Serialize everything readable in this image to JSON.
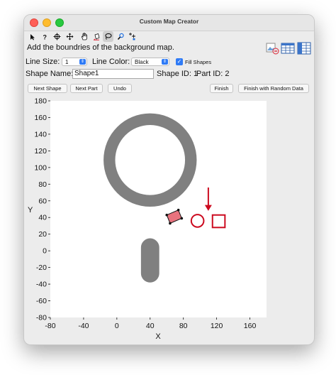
{
  "window": {
    "title": "Custom Map Creator"
  },
  "toolbar": {
    "tools": [
      "arrow-pointer-icon",
      "question-icon",
      "crosshair-icon",
      "move-icon",
      "hand-icon",
      "bucket-icon",
      "lasso-icon",
      "zoom-icon",
      "data-cursor-icon"
    ],
    "right_tools": [
      "image-export-icon",
      "table-icon",
      "table-columns-icon"
    ]
  },
  "instruction": "Add the boundries of the background map.",
  "controls": {
    "line_size_label": "Line Size:",
    "line_size_value": "1",
    "line_color_label": "Line Color:",
    "line_color_value": "Black",
    "fill_shapes_label": "Fill Shapes",
    "fill_shapes_checked": true,
    "shape_name_label": "Shape Name:",
    "shape_name_value": "Shape1",
    "shape_id_text": "Shape ID: 1",
    "part_id_text": "Part ID: 2"
  },
  "buttons": {
    "next_shape": "Next Shape",
    "next_part": "Next Part",
    "undo": "Undo",
    "finish": "Finish",
    "finish_random": "Finish with Random Data"
  },
  "plot": {
    "xlabel": "X",
    "ylabel": "Y",
    "xlim": [
      -80,
      180
    ],
    "ylim": [
      -80,
      180
    ],
    "x_ticks": [
      "-80",
      "-40",
      "0",
      "40",
      "80",
      "120",
      "160"
    ],
    "y_ticks": [
      "180",
      "160",
      "140",
      "120",
      "100",
      "80",
      "60",
      "40",
      "20",
      "0",
      "-20",
      "-40",
      "-60",
      "-80"
    ],
    "shape_color": "#808080",
    "selection_color": "#e8737e",
    "marker_color": "#cc0a1f"
  }
}
